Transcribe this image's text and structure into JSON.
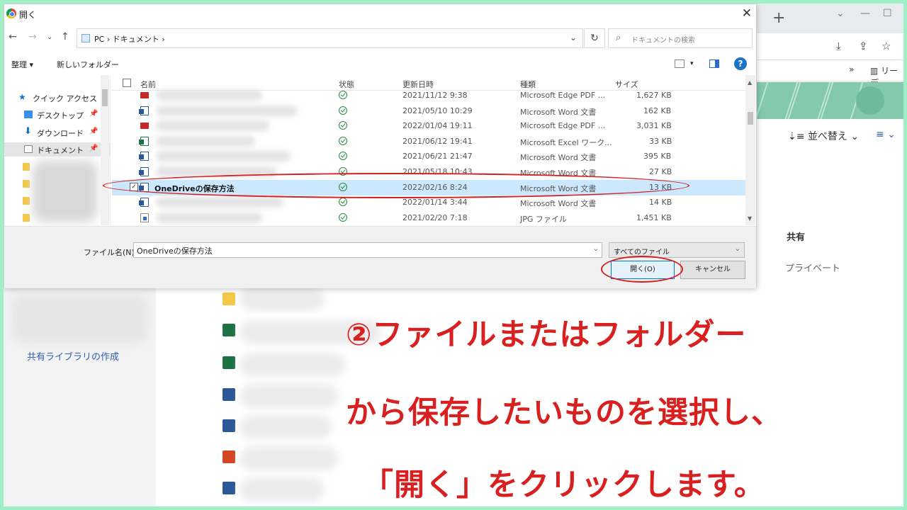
{
  "dialog": {
    "title": "開く",
    "path": "PC  ›  ドキュメント  ›",
    "search_placeholder": "ドキュメントの検索",
    "toolbar": {
      "organize": "整理 ▾",
      "new_folder": "新しいフォルダー",
      "help": "?"
    },
    "sidebar": [
      {
        "label": "クイック アクセス"
      },
      {
        "label": "デスクトップ"
      },
      {
        "label": "ダウンロード"
      },
      {
        "label": "ドキュメント"
      }
    ],
    "columns": {
      "name": "名前",
      "status": "状態",
      "date": "更新日時",
      "type": "種類",
      "size": "サイズ"
    },
    "files": [
      {
        "icon": "pdf-file-icon",
        "name": "",
        "date": "2021/11/12 9:38",
        "type": "Microsoft Edge PDF ...",
        "size": "1,627 KB"
      },
      {
        "icon": "word-file-icon",
        "name": "",
        "date": "2021/05/10 10:29",
        "type": "Microsoft Word 文書",
        "size": "162 KB"
      },
      {
        "icon": "pdf-file-icon",
        "name": "",
        "date": "2022/01/04 19:11",
        "type": "Microsoft Edge PDF ...",
        "size": "3,031 KB"
      },
      {
        "icon": "excel-file-icon",
        "name": "",
        "date": "2021/06/12 19:41",
        "type": "Microsoft Excel ワーク...",
        "size": "33 KB"
      },
      {
        "icon": "word-file-icon",
        "name": "",
        "date": "2021/06/21 21:47",
        "type": "Microsoft Word 文書",
        "size": "395 KB"
      },
      {
        "icon": "word-file-icon",
        "name": "",
        "date": "2021/05/18 10:43",
        "type": "Microsoft Word 文書",
        "size": "27 KB"
      },
      {
        "icon": "word-file-icon",
        "name": "OneDriveの保存方法",
        "date": "2022/02/16 8:24",
        "type": "Microsoft Word 文書",
        "size": "13 KB"
      },
      {
        "icon": "word-file-icon",
        "name": "",
        "date": "2022/01/14 3:44",
        "type": "Microsoft Word 文書",
        "size": "14 KB"
      },
      {
        "icon": "jpg-file-icon",
        "name": "",
        "date": "2021/02/20 7:18",
        "type": "JPG ファイル",
        "size": "1,451 KB"
      }
    ],
    "filename_label": "ファイル名(N):",
    "filename_value": "OneDriveの保存方法",
    "filetype_value": "すべてのファイル",
    "open_button": "開く(O)",
    "cancel_button": "キャンセル"
  },
  "background": {
    "sort_label": "並べ替え",
    "share_header": "共有",
    "private_label": "プライベート",
    "create_library": "共有ライブラリの作成",
    "bookmark_text": "リーデ"
  },
  "instruction": {
    "line1": "②ファイルまたはフォルダー",
    "line2": "から保存したいものを選択し、",
    "line3": "「開く」をクリックします。"
  },
  "colors": {
    "annotation": "#d82020",
    "frame": "#9ff0c6",
    "selection": "#cce8ff"
  }
}
